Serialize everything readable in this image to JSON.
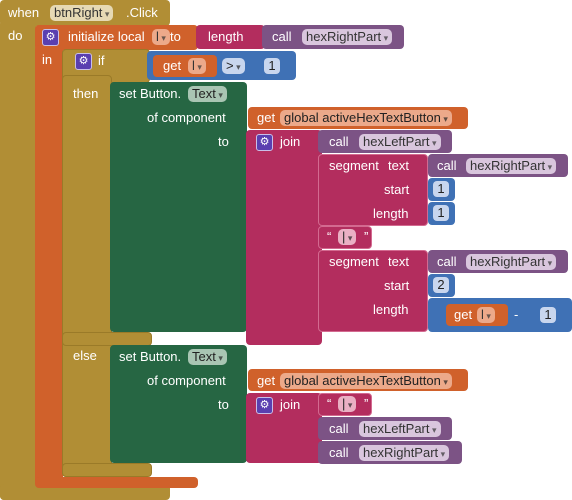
{
  "event": {
    "when": "when",
    "component": "btnRight",
    "event": ".Click",
    "do": "do"
  },
  "init": {
    "label": "initialize local",
    "var": "l",
    "to": "to",
    "in": "in"
  },
  "length": {
    "label": "length"
  },
  "call_label": "call",
  "procs": {
    "right": "hexRightPart",
    "left": "hexLeftPart"
  },
  "if": {
    "label": "if",
    "then": "then",
    "else": "else"
  },
  "get": "get",
  "compare": {
    "op": ">",
    "value": "1"
  },
  "set": {
    "label": "set Button.",
    "prop": "Text",
    "of_component": "of component",
    "to": "to"
  },
  "global": "global activeHexTextButton",
  "join": "join",
  "segment": {
    "label": "segment",
    "text": "text",
    "start": "start",
    "length": "length"
  },
  "seg1": {
    "start": "1",
    "length": "1"
  },
  "seg2": {
    "start": "2",
    "minus": "-",
    "minus_value": "1"
  },
  "string": {
    "value": "|",
    "open": "“",
    "close": "”"
  },
  "colors": {
    "event": "#b18e35",
    "local": "#d0612b",
    "text": "#b32d5e",
    "procedure": "#7c5385",
    "math": "#3f71b5",
    "component": "#266643"
  }
}
